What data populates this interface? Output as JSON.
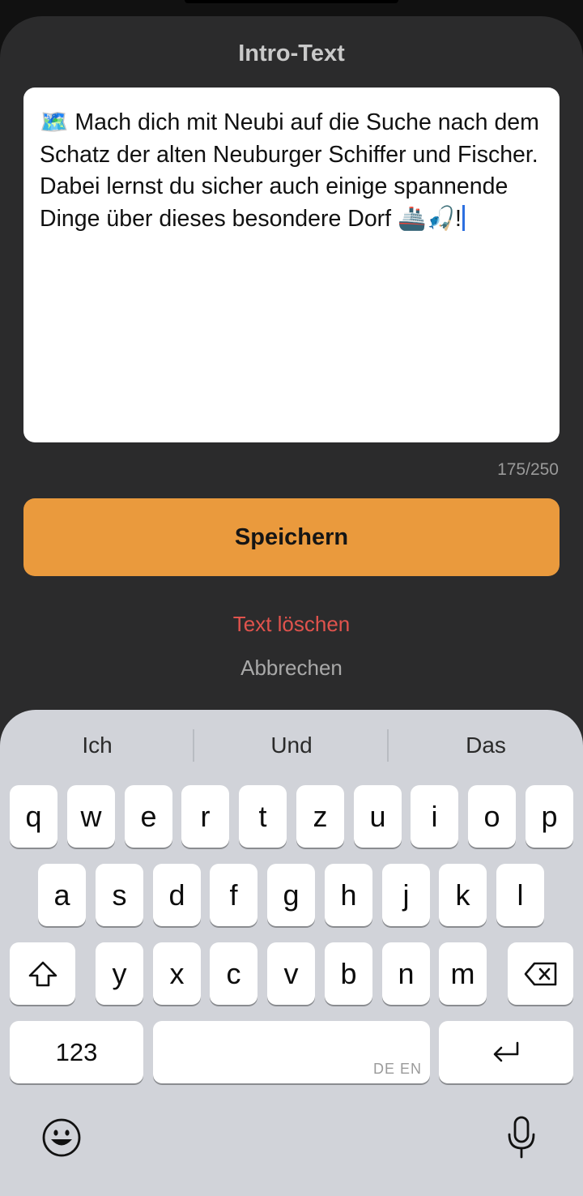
{
  "sheet": {
    "title": "Intro-Text",
    "text": "🗺️ Mach dich mit Neubi auf die Suche nach dem Schatz der alten Neuburger Schiffer und Fischer. Dabei lernst du sicher auch einige spannende Dinge über dieses besondere Dorf 🚢🎣!",
    "counter": "175/250",
    "save_label": "Speichern",
    "delete_label": "Text löschen",
    "cancel_label": "Abbrechen"
  },
  "keyboard": {
    "suggestions": [
      "Ich",
      "Und",
      "Das"
    ],
    "row1": [
      "q",
      "w",
      "e",
      "r",
      "t",
      "z",
      "u",
      "i",
      "o",
      "p"
    ],
    "row2": [
      "a",
      "s",
      "d",
      "f",
      "g",
      "h",
      "j",
      "k",
      "l"
    ],
    "row3": [
      "y",
      "x",
      "c",
      "v",
      "b",
      "n",
      "m"
    ],
    "numbers_label": "123",
    "language_label": "DE EN",
    "icons": {
      "shift": "shift-icon",
      "delete": "backspace-icon",
      "return": "return-icon",
      "emoji": "emoji-icon",
      "dictation": "microphone-icon"
    }
  }
}
